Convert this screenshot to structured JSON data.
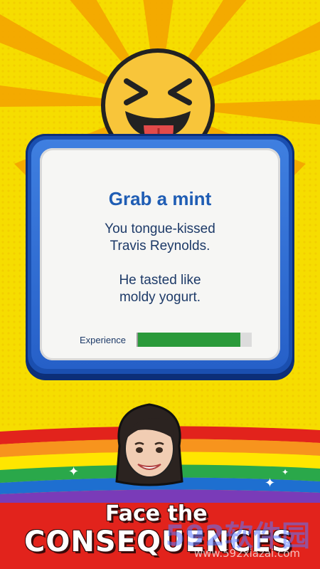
{
  "card": {
    "title": "Grab a mint",
    "message_1": "You tongue-kissed\nTravis Reynolds.",
    "message_2": "He tasted like\nmoldy yogurt.",
    "experience_label": "Experience",
    "experience_progress_percent": 90
  },
  "banner": {
    "line1": "Face the",
    "line2": "CONSEQUENCES"
  },
  "watermark": {
    "brand": "592软件园",
    "url": "www.592xiazai.com"
  },
  "icons": {
    "top_emoji": "tongue-out-squint-emoji-icon",
    "avatar": "female-avatar-icon",
    "sparkle": "sparkle-icon"
  },
  "colors": {
    "background_yellow": "#f6dd00",
    "sunburst": "#f4a500",
    "card_border_blue": "#1a4fb0",
    "title_blue": "#1f5db4",
    "text_navy": "#1d3a68",
    "progress_green": "#2a9a3a",
    "banner_red": "#e2231c"
  }
}
